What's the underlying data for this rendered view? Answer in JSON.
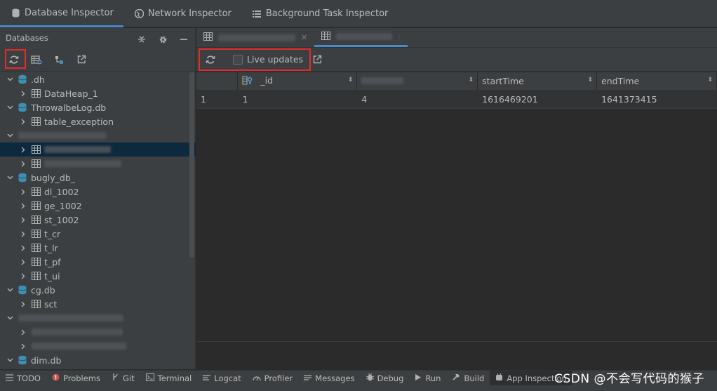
{
  "top_tabs": [
    {
      "label": "Database Inspector",
      "icon": "database-icon",
      "active": true
    },
    {
      "label": "Network Inspector",
      "icon": "globe-icon",
      "active": false
    },
    {
      "label": "Background Task Inspector",
      "icon": "list-icon",
      "active": false
    }
  ],
  "left": {
    "header": "Databases",
    "tree": [
      {
        "type": "db",
        "label": ".dh",
        "expanded": true
      },
      {
        "type": "table",
        "label": "DataHeap_1"
      },
      {
        "type": "db",
        "label": "ThrowalbeLog.db",
        "expanded": true
      },
      {
        "type": "table",
        "label": "table_exception"
      },
      {
        "type": "db",
        "label": "",
        "expanded": true,
        "blurred": true
      },
      {
        "type": "table",
        "label": "",
        "blurred": true,
        "selected": true
      },
      {
        "type": "table",
        "label": "",
        "blurred": true
      },
      {
        "type": "db",
        "label": "bugly_db_",
        "expanded": true
      },
      {
        "type": "table",
        "label": "dl_1002"
      },
      {
        "type": "table",
        "label": "ge_1002"
      },
      {
        "type": "table",
        "label": "st_1002"
      },
      {
        "type": "table",
        "label": "t_cr"
      },
      {
        "type": "table",
        "label": "t_lr"
      },
      {
        "type": "table",
        "label": "t_pf"
      },
      {
        "type": "table",
        "label": "t_ui"
      },
      {
        "type": "db",
        "label": "cg.db",
        "expanded": true
      },
      {
        "type": "table",
        "label": "sct"
      },
      {
        "type": "db",
        "label": "",
        "expanded": true,
        "blurred": true
      },
      {
        "type": "table",
        "label": "",
        "blurred": true
      },
      {
        "type": "table",
        "label": "",
        "blurred": true
      },
      {
        "type": "db",
        "label": "dim.db",
        "expanded": true
      }
    ]
  },
  "right": {
    "live_updates_label": "Live updates",
    "columns": [
      "_id",
      "",
      "startTime",
      "endTime"
    ],
    "rows": [
      {
        "row_num": "1",
        "cells": [
          "1",
          "4",
          "1616469201",
          "1641373415"
        ]
      }
    ]
  },
  "bottom_tabs": [
    {
      "label": "TODO",
      "icon": "list-icon"
    },
    {
      "label": "Problems",
      "icon": "error-icon"
    },
    {
      "label": "Git",
      "icon": "git-icon"
    },
    {
      "label": "Terminal",
      "icon": "terminal-icon"
    },
    {
      "label": "Logcat",
      "icon": "logcat-icon"
    },
    {
      "label": "Profiler",
      "icon": "profiler-icon"
    },
    {
      "label": "Messages",
      "icon": "messages-icon"
    },
    {
      "label": "Debug",
      "icon": "bug-icon"
    },
    {
      "label": "Run",
      "icon": "run-icon"
    },
    {
      "label": "Build",
      "icon": "hammer-icon"
    },
    {
      "label": "App Inspection",
      "icon": "inspection-icon",
      "active": true
    }
  ],
  "watermark": "CSDN @不会写代码的猴子",
  "colors": {
    "accent": "#4a88c7",
    "highlight_red": "#e22b2b",
    "selection": "#0d293e",
    "db_icon": "#3e8fb0"
  }
}
